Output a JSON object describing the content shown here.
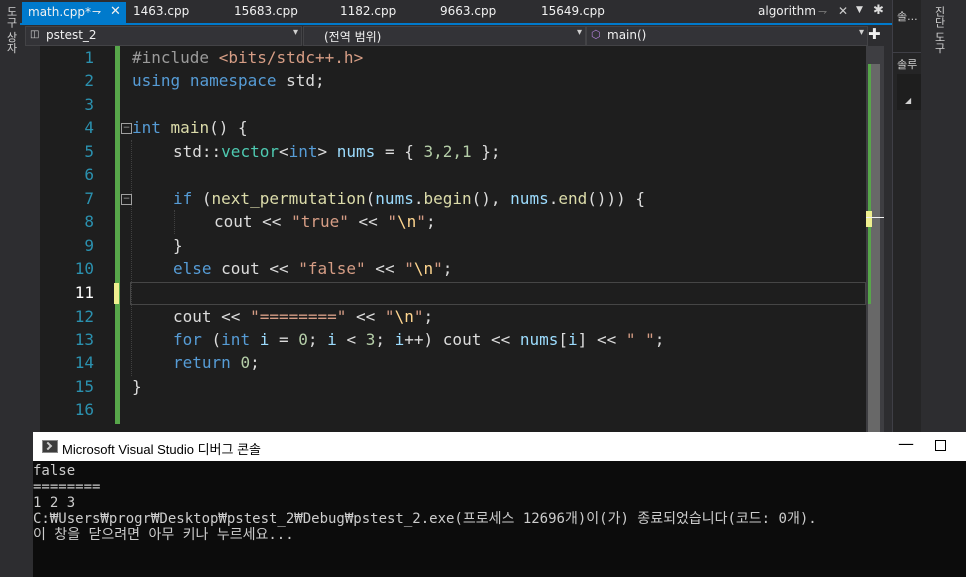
{
  "left_strip": {
    "label": "도구 상자"
  },
  "right_strip": {
    "label": "진단 도구"
  },
  "right_panel": {
    "tab_label": "솔...",
    "sub_label": "솔루"
  },
  "tabs": {
    "active": {
      "label": "math.cpp*",
      "pin": "⇁",
      "close": "✕"
    },
    "others": [
      {
        "label": "1463.cpp"
      },
      {
        "label": "15683.cpp"
      },
      {
        "label": "1182.cpp"
      },
      {
        "label": "9663.cpp"
      },
      {
        "label": "15649.cpp"
      }
    ],
    "preview": {
      "label": "algorithm"
    }
  },
  "nav": {
    "project": "pstest_2",
    "scope": "(전역 범위)",
    "member": "main()"
  },
  "editor": {
    "line_numbers": [
      "1",
      "2",
      "3",
      "4",
      "5",
      "6",
      "7",
      "8",
      "9",
      "10",
      "11",
      "12",
      "13",
      "14",
      "15",
      "16"
    ],
    "current_line": "11",
    "lines": {
      "l1_pp": "#include ",
      "l1_hdr": "<bits/stdc++.h>",
      "l2_kw1": "using",
      "l2_kw2": "namespace",
      "l2_rest": " std;",
      "l4_kw": "int",
      "l4_fn": "main",
      "l4_rest": "() {",
      "l5_a": "std::",
      "l5_ty": "vector",
      "l5_lt": "<",
      "l5_kw": "int",
      "l5_gt": "> ",
      "l5_var": "nums",
      "l5_b": " = { ",
      "l5_n": "3,2,1",
      "l5_c": " };",
      "l7_if": "if",
      "l7_a": " (",
      "l7_fn": "next_permutation",
      "l7_b": "(",
      "l7_v1": "nums",
      "l7_c": ".",
      "l7_f1": "begin",
      "l7_d": "(), ",
      "l7_v2": "nums",
      "l7_e": ".",
      "l7_f2": "end",
      "l7_f": "())) {",
      "l8_a": "cout << ",
      "l8_s": "\"true\"",
      "l8_b": " << ",
      "l8_q1": "\"",
      "l8_esc": "\\n",
      "l8_q2": "\"",
      "l8_c": ";",
      "l9": "}",
      "l10_kw": "else",
      "l10_a": " cout << ",
      "l10_s": "\"false\"",
      "l10_b": " << ",
      "l10_q1": "\"",
      "l10_esc": "\\n",
      "l10_q2": "\"",
      "l10_c": ";",
      "l12_a": "cout << ",
      "l12_s": "\"========\"",
      "l12_b": " << ",
      "l12_q1": "\"",
      "l12_esc": "\\n",
      "l12_q2": "\"",
      "l12_c": ";",
      "l13_for": "for",
      "l13_a": " (",
      "l13_int": "int",
      "l13_b": " ",
      "l13_i": "i",
      "l13_c": " = ",
      "l13_0": "0",
      "l13_d": "; ",
      "l13_i2": "i",
      "l13_e": " < ",
      "l13_3": "3",
      "l13_f": "; ",
      "l13_i3": "i",
      "l13_g": "++) cout << ",
      "l13_nums": "nums",
      "l13_h": "[",
      "l13_i4": "i",
      "l13_j": "] << ",
      "l13_s": "\" \"",
      "l13_k": ";",
      "l14_kw": "return",
      "l14_a": " ",
      "l14_n": "0",
      "l14_b": ";",
      "l15": "}"
    }
  },
  "console": {
    "title": "Microsoft Visual Studio 디버그 콘솔",
    "minimize": "—",
    "lines": [
      "false",
      "========",
      "1 2 3",
      "C:₩Users₩progr₩Desktop₩pstest_2₩Debug₩pstest_2.exe(프로세스 12696개)이(가) 종료되었습니다(코드: 0개).",
      "이 창을 닫으려면 아무 키나 누르세요..."
    ]
  },
  "colors": {
    "accent": "#007acc",
    "editor_bg": "#1e1e1e",
    "change_bar": "#57a64a"
  }
}
